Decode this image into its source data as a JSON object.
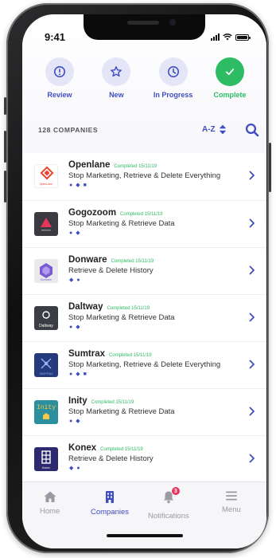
{
  "status_bar": {
    "time": "9:41"
  },
  "filters": [
    {
      "label": "Review",
      "icon": "exclamation-circle-icon",
      "active": false
    },
    {
      "label": "New",
      "icon": "star-icon",
      "active": false
    },
    {
      "label": "In Progress",
      "icon": "clock-icon",
      "active": false
    },
    {
      "label": "Complete",
      "icon": "checkmark-icon",
      "active": true
    }
  ],
  "list_header": {
    "count": "128 COMPANIES",
    "sort_label": "A-Z"
  },
  "companies": [
    {
      "name": "Openlane",
      "status": "Completed 15/11/19",
      "action": "Stop Marketing, Retrieve & Delete Everything",
      "logo_caption": "OpenLane",
      "logo_bg": "#ffffff",
      "logo_fg": "#e8442e",
      "mini": [
        "●",
        "◆",
        "■"
      ]
    },
    {
      "name": "Gogozoom",
      "status": "Completed 15/11/19",
      "action": "Stop Marketing & Retrieve Data",
      "logo_caption": "",
      "logo_bg": "#3a3a40",
      "logo_fg": "#e8355c",
      "mini": [
        "●",
        "◆"
      ]
    },
    {
      "name": "Donware",
      "status": "Completed 15/11/19",
      "action": "Retrieve & Delete History",
      "logo_caption": "Donware",
      "logo_bg": "#e9e9ee",
      "logo_fg": "#7a5bd0",
      "mini": [
        "◆",
        "●"
      ]
    },
    {
      "name": "Daltway",
      "status": "Completed 15/11/19",
      "action": "Stop Marketing & Retrieve Data",
      "logo_caption": "Daltway",
      "logo_bg": "#3a3d44",
      "logo_fg": "#ffffff",
      "mini": [
        "●",
        "◆"
      ]
    },
    {
      "name": "Sumtrax",
      "status": "Completed 15/11/19",
      "action": "Stop Marketing, Retrieve & Delete Everything",
      "logo_caption": "SUMTRAX",
      "logo_bg": "#243a7a",
      "logo_fg": "#8fb4ff",
      "mini": [
        "●",
        "◆",
        "■"
      ]
    },
    {
      "name": "Inity",
      "status": "Completed 15/11/19",
      "action": "Stop Marketing & Retrieve Data",
      "logo_caption": "Inity",
      "logo_bg": "#2c8f9e",
      "logo_fg": "#f5c84a",
      "mini": [
        "●",
        "◆"
      ]
    },
    {
      "name": "Konex",
      "status": "Completed 15/11/19",
      "action": "Retrieve & Delete History",
      "logo_caption": "Konex",
      "logo_bg": "#2c2a6e",
      "logo_fg": "#ffffff",
      "mini": [
        "◆",
        "●"
      ]
    }
  ],
  "nav": [
    {
      "label": "Home",
      "icon": "house-icon",
      "active": false
    },
    {
      "label": "Companies",
      "icon": "building-icon",
      "active": true
    },
    {
      "label": "Notifications",
      "icon": "bell-icon",
      "active": false,
      "badge": "3"
    },
    {
      "label": "Menu",
      "icon": "hamburger-icon",
      "active": false
    }
  ],
  "colors": {
    "accent": "#3f4dc1",
    "success": "#2dbb63",
    "badge": "#e8355c"
  }
}
